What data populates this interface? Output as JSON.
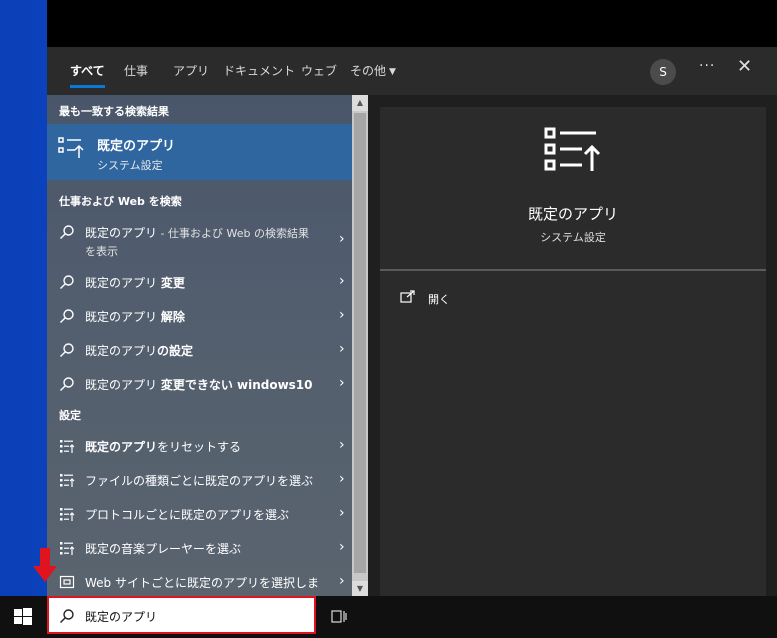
{
  "tabs": [
    "すべて",
    "仕事",
    "アプリ",
    "ドキュメント",
    "ウェブ",
    "その他"
  ],
  "avatar_letter": "S",
  "more_label": "···",
  "close_label": "✕",
  "sections": {
    "best_match": "最も一致する検索結果",
    "web_search": "仕事および Web を検索",
    "settings": "設定"
  },
  "best_match": {
    "title": "既定のアプリ",
    "subtitle": "システム設定"
  },
  "web_results": [
    {
      "base": "既定のアプリ",
      "bold": "",
      "suffix": " - 仕事および Web の検索結果",
      "line2": "を表示"
    },
    {
      "base": "既定のアプリ ",
      "bold": "変更",
      "suffix": "",
      "line2": ""
    },
    {
      "base": "既定のアプリ ",
      "bold": "解除",
      "suffix": "",
      "line2": ""
    },
    {
      "base": "既定のアプリ",
      "bold": "の設定",
      "suffix": "",
      "line2": ""
    },
    {
      "base": "既定のアプリ ",
      "bold": "変更できない windows10",
      "suffix": "",
      "line2": ""
    }
  ],
  "settings_results": [
    {
      "bold": "既定のアプリ",
      "rest": "をリセットする"
    },
    {
      "bold": "",
      "rest": "ファイルの種類ごとに既定のアプリを選ぶ"
    },
    {
      "bold": "",
      "rest": "プロトコルごとに既定のアプリを選ぶ"
    },
    {
      "bold": "",
      "rest": "既定の音楽プレーヤーを選ぶ"
    },
    {
      "bold": "",
      "rest": "Web サイトごとに既定のアプリを選択しま"
    }
  ],
  "preview": {
    "title": "既定のアプリ",
    "subtitle": "システム設定",
    "open_label": "開く"
  },
  "search": {
    "value": "既定のアプリ"
  },
  "colors": {
    "accent": "#0a78d4",
    "highlight": "#2f66a0",
    "search_border": "#e0141e"
  }
}
